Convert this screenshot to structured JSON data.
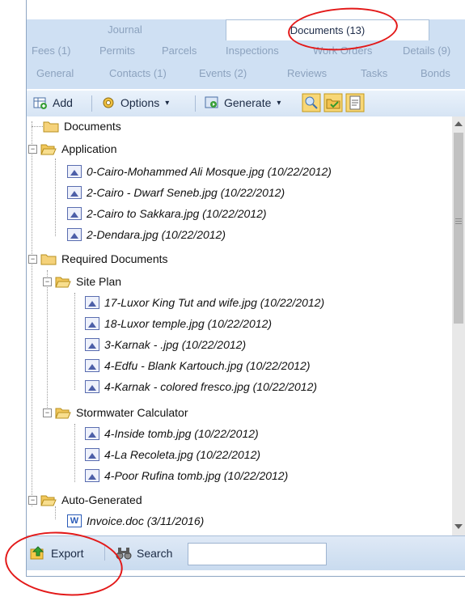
{
  "tabs": {
    "top": [
      {
        "label": "Journal",
        "active": false
      },
      {
        "label": "Documents (13)",
        "active": true
      }
    ],
    "row1": [
      "Fees (1)",
      "Permits",
      "Parcels",
      "Inspections",
      "Work Orders",
      "Details (9)"
    ],
    "row2": [
      "General",
      "Contacts (1)",
      "Events (2)",
      "Reviews",
      "Tasks",
      "Bonds"
    ]
  },
  "toolbar": {
    "add_label": "Add",
    "options_label": "Options",
    "generate_label": "Generate"
  },
  "tree": {
    "documents": "Documents",
    "application": {
      "label": "Application",
      "files": [
        "0-Cairo-Mohammed Ali Mosque.jpg (10/22/2012)",
        "2-Cairo - Dwarf Seneb.jpg (10/22/2012)",
        "2-Cairo to Sakkara.jpg (10/22/2012)",
        "2-Dendara.jpg (10/22/2012)"
      ]
    },
    "required": {
      "label": "Required Documents",
      "site_plan": {
        "label": "Site Plan",
        "files": [
          "17-Luxor King Tut and wife.jpg (10/22/2012)",
          "18-Luxor temple.jpg (10/22/2012)",
          "3-Karnak - .jpg (10/22/2012)",
          "4-Edfu - Blank Kartouch.jpg (10/22/2012)",
          "4-Karnak - colored fresco.jpg (10/22/2012)"
        ]
      },
      "stormwater": {
        "label": "Stormwater Calculator",
        "files": [
          "4-Inside tomb.jpg (10/22/2012)",
          "4-La Recoleta.jpg (10/22/2012)",
          "4-Poor Rufina tomb.jpg (10/22/2012)"
        ]
      }
    },
    "auto": {
      "label": "Auto-Generated",
      "files": [
        "Invoice.doc (3/11/2016)"
      ]
    }
  },
  "bottom": {
    "export_label": "Export",
    "search_label": "Search",
    "search_value": ""
  },
  "colors": {
    "annotation_red": "#e31919",
    "tab_strip": "#cfe0f3"
  }
}
